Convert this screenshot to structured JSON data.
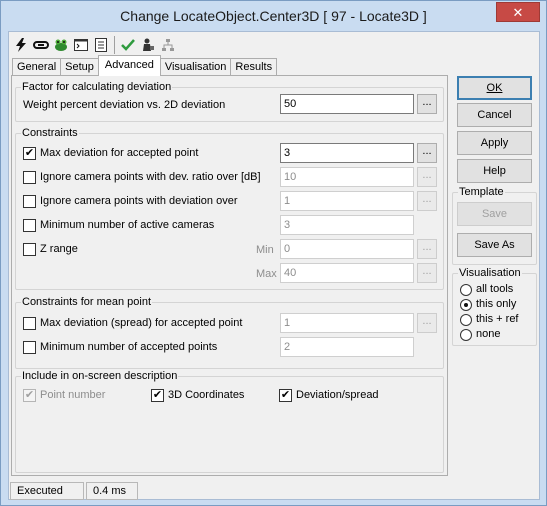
{
  "window": {
    "title": "Change LocateObject.Center3D [ 97 - Locate3D ]",
    "close_glyph": "✕"
  },
  "toolbar": {
    "icons": [
      "lightning-icon",
      "link-icon",
      "frog-icon",
      "console-icon",
      "list-icon",
      "checkmark-icon",
      "person-camera-icon",
      "network-icon"
    ]
  },
  "tabs": [
    "General",
    "Setup",
    "Advanced",
    "Visualisation",
    "Results"
  ],
  "factor": {
    "title": "Factor for calculating deviation",
    "weight_label": "Weight percent deviation vs. 2D deviation",
    "weight_value": "50"
  },
  "constraints": {
    "title": "Constraints",
    "max_dev": {
      "label": "Max deviation for accepted point",
      "checked": "✔",
      "value": "3"
    },
    "ignore_ratio": {
      "label": "Ignore camera points with dev. ratio over [dB]",
      "value": "10"
    },
    "ignore_dev": {
      "label": "Ignore camera points with deviation over",
      "value": "1"
    },
    "min_cameras": {
      "label": "Minimum number of active cameras",
      "value": "3"
    },
    "z_range": {
      "label": "Z range",
      "min_label": "Min",
      "min_value": "0",
      "max_label": "Max",
      "max_value": "40"
    }
  },
  "mean_point": {
    "title": "Constraints for mean point",
    "max_spread": {
      "label": "Max deviation (spread) for accepted point",
      "value": "1"
    },
    "min_points": {
      "label": "Minimum number of accepted points",
      "value": "2"
    }
  },
  "onscreen": {
    "title": "Include in on-screen description",
    "point_number": {
      "label": "Point number",
      "checked": "✔"
    },
    "coords": {
      "label": "3D Coordinates",
      "checked": "✔"
    },
    "deviation": {
      "label": "Deviation/spread",
      "checked": "✔"
    }
  },
  "dots_label": "...",
  "buttons": {
    "ok": "OK",
    "cancel": "Cancel",
    "apply": "Apply",
    "help": "Help"
  },
  "template": {
    "title": "Template",
    "save": "Save",
    "save_as": "Save As"
  },
  "visualisation": {
    "title": "Visualisation",
    "options": [
      "all tools",
      "this only",
      "this + ref",
      "none"
    ],
    "selected": "this only"
  },
  "status": {
    "state": "Executed",
    "time": "0.4 ms"
  },
  "colors": {
    "accent": "#3c7fb1",
    "close": "#c74a45",
    "check_green": "#2f9b3f"
  }
}
